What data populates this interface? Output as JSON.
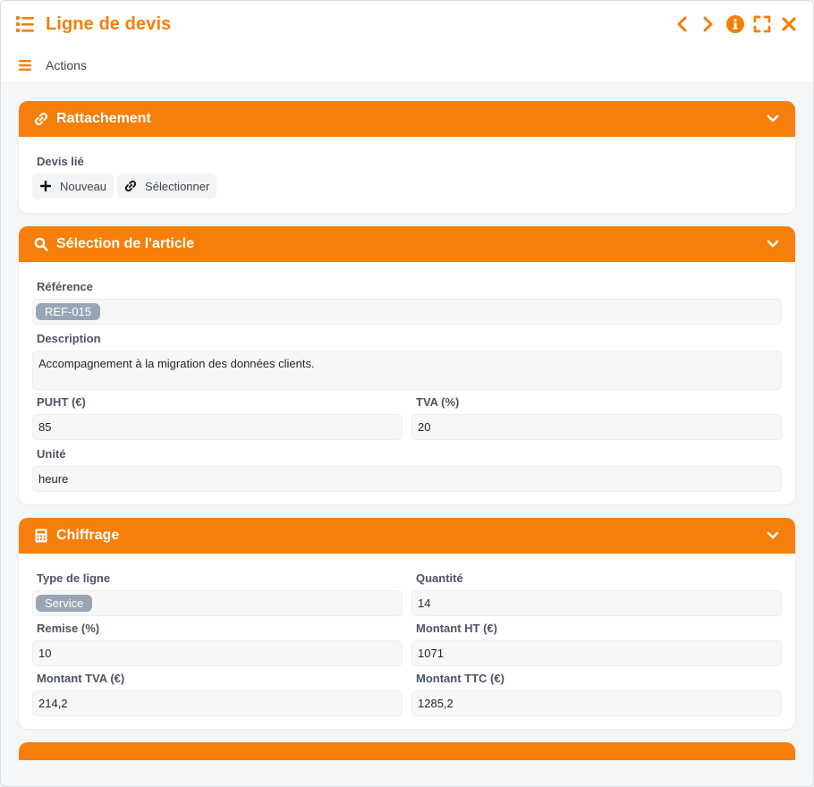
{
  "window": {
    "title": "Ligne de devis",
    "accent": "#f57f0a",
    "tools": [
      "chevron-left-icon",
      "chevron-right-icon",
      "info-icon",
      "expand-icon",
      "close-icon"
    ]
  },
  "actionsbar": {
    "label": "Actions"
  },
  "sections": {
    "rattachement": {
      "title": "Rattachement",
      "icon": "link-icon",
      "devis_lie_label": "Devis lié",
      "new_button": "Nouveau",
      "select_button": "Sélectionner"
    },
    "article": {
      "title": "Sélection de l'article",
      "icon": "search-icon",
      "reference_label": "Référence",
      "reference_value": "REF-015",
      "description_label": "Description",
      "description_value": "Accompagnement à la migration des données clients.",
      "puht_label": "PUHT (€)",
      "puht_value": "85",
      "tva_label": "TVA (%)",
      "tva_value": "20",
      "unite_label": "Unité",
      "unite_value": "heure"
    },
    "chiffrage": {
      "title": "Chiffrage",
      "icon": "calculator-icon",
      "type_label": "Type de ligne",
      "type_value": "Service",
      "quantite_label": "Quantité",
      "quantite_value": "14",
      "remise_label": "Remise (%)",
      "remise_value": "10",
      "montant_ht_label": "Montant HT (€)",
      "montant_ht_value": "1071",
      "montant_tva_label": "Montant TVA (€)",
      "montant_tva_value": "214,2",
      "montant_ttc_label": "Montant TTC (€)",
      "montant_ttc_value": "1285,2"
    }
  }
}
